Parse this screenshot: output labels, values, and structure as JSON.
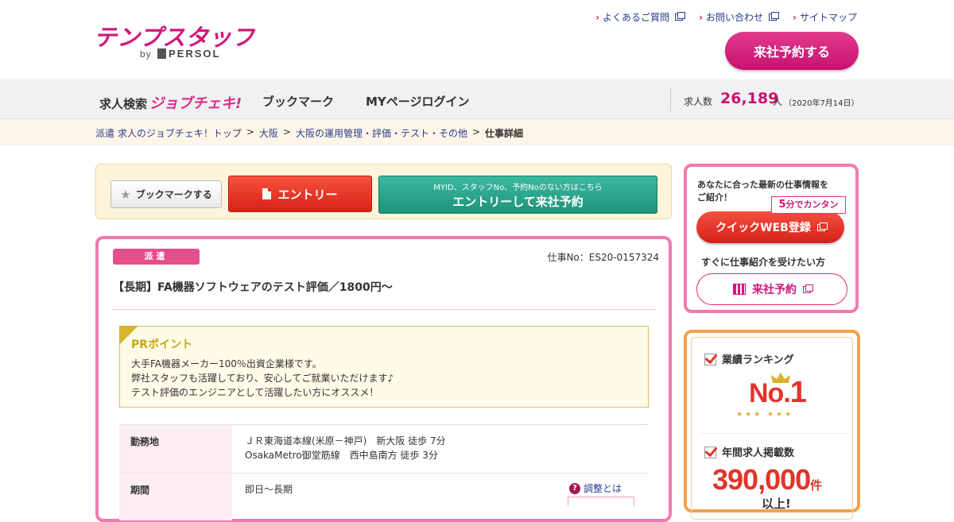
{
  "header": {
    "logo_text": "テンプスタッフ",
    "logo_by": "by",
    "logo_brand": "PERSOL",
    "top_links": [
      "よくあるご質問",
      "お問い合わせ",
      "サイトマップ"
    ],
    "reserve_label": "来社予約する"
  },
  "nav": {
    "search_label": "求人検索",
    "jobcheck_label": "ジョブチェキ!",
    "bookmark_label": "ブックマーク",
    "mypage_label": "MYページログイン",
    "count_label": "求人数",
    "count_value": "26,189",
    "count_unit": "人",
    "count_date": "（2020年7月14日）"
  },
  "breadcrumb": {
    "items": [
      "派遣 求人のジョブチェキ！トップ",
      "大阪",
      "大阪の運用管理・評価・テスト・その他"
    ],
    "current": "仕事詳細",
    "separator": ">"
  },
  "actions": {
    "bookmark_label": "ブックマークする",
    "entry_label": "エントリー",
    "entry2_sub": "MYID、スタッフNo、予約Noのない方はこちら",
    "entry2_label": "エントリーして来社予約"
  },
  "job": {
    "type_badge": "派遣",
    "job_no": "仕事No：ES20-0157324",
    "title": "【長期】FA機器ソフトウェアのテスト評価／1800円～",
    "pr_title": "PRポイント",
    "pr_lines": [
      "大手FA機器メーカー100％出資企業様です。",
      "弊社スタッフも活躍しており、安心してご就業いただけます♪",
      "テスト評価のエンジニアとして活躍したい方にオススメ！"
    ],
    "rows": [
      {
        "label": "勤務地",
        "lines": [
          "ＪＲ東海道本線(米原－神戸)　新大阪 徒歩 7分",
          "OsakaMetro御堂筋線　西中島南方 徒歩 3分"
        ]
      },
      {
        "label": "期間",
        "lines": [
          "即日～長期"
        ]
      }
    ],
    "adjust_label": "調整とは",
    "adjust_icon": "?"
  },
  "sidebar": {
    "promo_text_1": "あなたに合った最新の仕事情報を",
    "promo_text_2": "ご紹介！",
    "tag_num": "5",
    "tag_text": "分でカンタン",
    "quick_label": "クイックWEB登録",
    "receive_text": "すぐに仕事紹介を受けたい方",
    "raisha_label": "来社予約",
    "rank_heading": "業績ランキング",
    "rank_no": "No.",
    "rank_value": "1",
    "listing_heading": "年間求人掲載数",
    "listing_value": "390,000",
    "listing_unit": "件",
    "listing_suffix": "以上!"
  },
  "colors": {
    "brand_pink": "#d0187b",
    "entry_red": "#e5382a",
    "entry_green": "#1e9478",
    "link_blue": "#2a3b8f"
  }
}
